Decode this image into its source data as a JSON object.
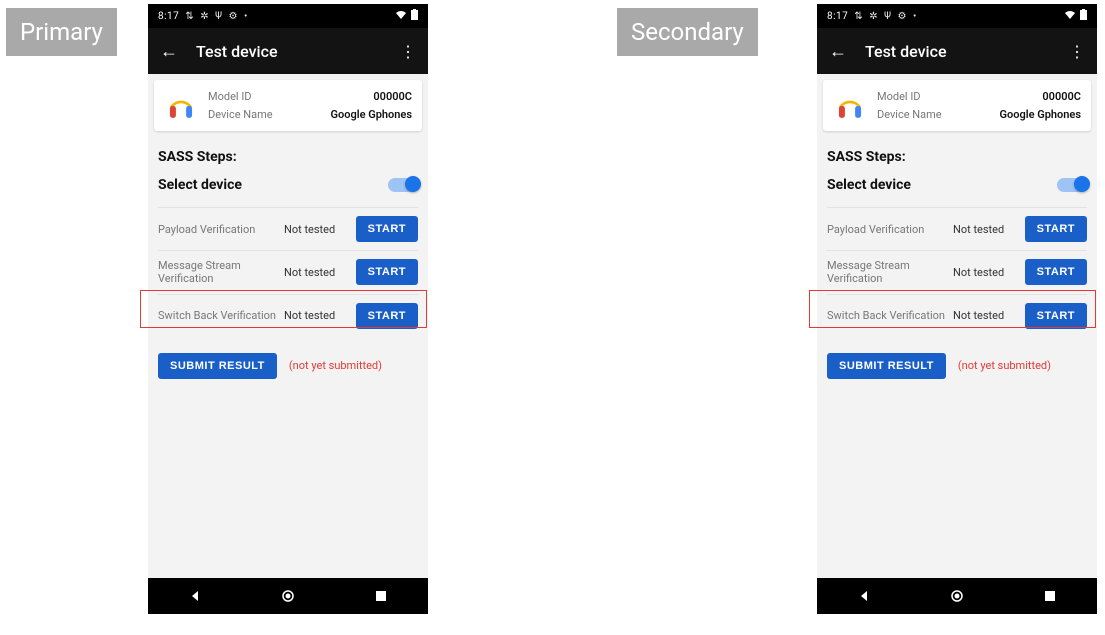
{
  "labels": {
    "primary": "Primary",
    "secondary": "Secondary"
  },
  "statusbar": {
    "time": "8:17",
    "icons": [
      "⇵",
      "✲",
      "⦿",
      "⚙",
      "•"
    ],
    "right": [
      "wifi",
      "batt"
    ]
  },
  "appbar": {
    "title": "Test device"
  },
  "card": {
    "model_key": "Model ID",
    "model_val": "00000C",
    "name_key": "Device Name",
    "name_val": "Google Gphones"
  },
  "sass": {
    "heading": "SASS Steps:",
    "select": "Select device",
    "tests": [
      {
        "name": "Payload Verification",
        "status": "Not tested",
        "action": "START"
      },
      {
        "name": "Message Stream Verification",
        "status": "Not tested",
        "action": "START"
      },
      {
        "name": "Switch Back Verification",
        "status": "Not tested",
        "action": "START"
      }
    ]
  },
  "submit": {
    "label": "SUBMIT RESULT",
    "status": "(not yet submitted)"
  }
}
